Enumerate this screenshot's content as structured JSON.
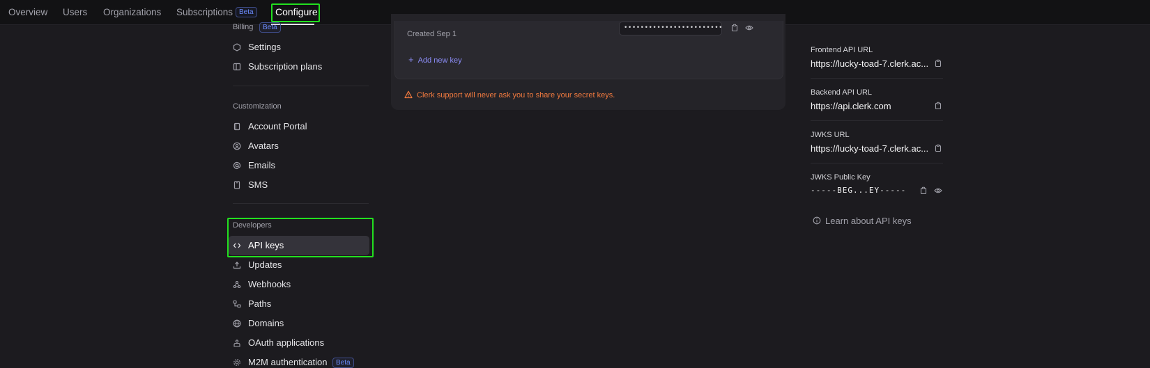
{
  "topnav": {
    "items": [
      "Overview",
      "Users",
      "Organizations",
      "Subscriptions"
    ],
    "subscriptions_badge": "Beta",
    "active": "Configure"
  },
  "sidebar": {
    "billing_header": "Billing",
    "billing_badge": "Beta",
    "billing_items": [
      {
        "label": "Settings",
        "icon": "hexagon-icon"
      },
      {
        "label": "Subscription plans",
        "icon": "columns-icon"
      }
    ],
    "customization_header": "Customization",
    "customization_items": [
      {
        "label": "Account Portal",
        "icon": "bookmark-icon"
      },
      {
        "label": "Avatars",
        "icon": "user-circle-icon"
      },
      {
        "label": "Emails",
        "icon": "at-icon"
      },
      {
        "label": "SMS",
        "icon": "phone-icon"
      }
    ],
    "developers_header": "Developers",
    "developers_items": [
      {
        "label": "API keys",
        "icon": "code-icon"
      },
      {
        "label": "Updates",
        "icon": "upload-icon"
      },
      {
        "label": "Webhooks",
        "icon": "webhook-icon"
      },
      {
        "label": "Paths",
        "icon": "paths-icon"
      },
      {
        "label": "Domains",
        "icon": "globe-icon"
      },
      {
        "label": "OAuth applications",
        "icon": "oauth-icon"
      },
      {
        "label": "M2M authentication",
        "icon": "gear-icon"
      }
    ],
    "m2m_badge": "Beta"
  },
  "main": {
    "key_created": "Created Sep 1",
    "key_masked": "••••••••••••••••••••••••",
    "add_key_label": "Add new key",
    "warning": "Clerk support will never ask you to share your secret keys."
  },
  "right_panel": {
    "fields": [
      {
        "label": "Frontend API URL",
        "value": "https://lucky-toad-7.clerk.ac..."
      },
      {
        "label": "Backend API URL",
        "value": "https://api.clerk.com"
      },
      {
        "label": "JWKS URL",
        "value": "https://lucky-toad-7.clerk.ac..."
      },
      {
        "label": "JWKS Public Key",
        "value": "-----BEG...EY-----"
      }
    ],
    "learn_link": "Learn about API keys"
  },
  "colors": {
    "highlight": "#22e01f",
    "warning": "#f47b3f",
    "link": "#8b8cf5",
    "badge": "#6c8cff"
  }
}
